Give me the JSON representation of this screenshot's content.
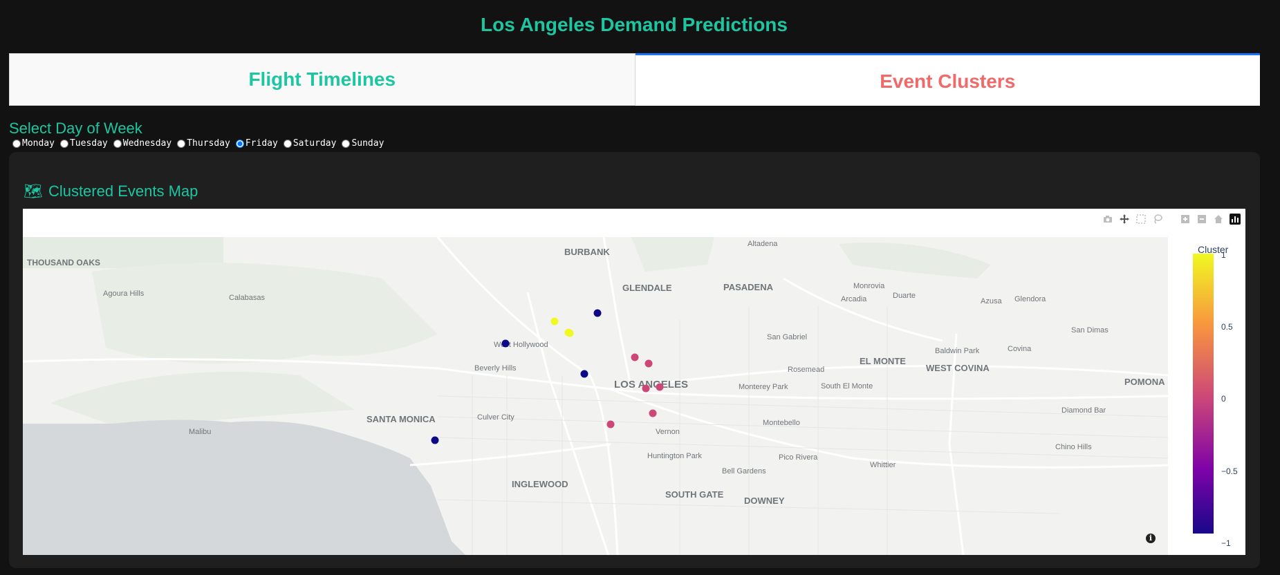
{
  "app": {
    "title": "Los Angeles Demand Predictions"
  },
  "tabs": [
    {
      "label": "Flight Timelines",
      "active": false
    },
    {
      "label": "Event Clusters",
      "active": true
    }
  ],
  "day_selector": {
    "label": "Select Day of Week",
    "options": [
      "Monday",
      "Tuesday",
      "Wednesday",
      "Thursday",
      "Friday",
      "Saturday",
      "Sunday"
    ],
    "selected": "Friday"
  },
  "map_section": {
    "icon": "map-icon",
    "emoji": "🗺",
    "title": "Clustered Events Map"
  },
  "modebar": [
    "camera-icon",
    "pan-icon",
    "box-select-icon",
    "lasso-icon",
    "zoom-in-icon",
    "zoom-out-icon",
    "home-icon",
    "plotly-logo-icon"
  ],
  "map_labels": [
    "THOUSAND OAKS",
    "Agoura Hills",
    "Calabasas",
    "Malibu",
    "BURBANK",
    "GLENDALE",
    "PASADENA",
    "Altadena",
    "Monrovia",
    "Duarte",
    "Arcadia",
    "Azusa",
    "Glendora",
    "San Dimas",
    "West Hollywood",
    "Beverly Hills",
    "LOS ANGELES",
    "SANTA MONICA",
    "Culver City",
    "San Gabriel",
    "EL MONTE",
    "Rosemead",
    "Baldwin Park",
    "Covina",
    "WEST COVINA",
    "Monterey Park",
    "South El Monte",
    "POMONA",
    "Diamond Bar",
    "Montebello",
    "Vernon",
    "Huntington Park",
    "Pico Rivera",
    "Whittier",
    "Chino Hills",
    "Bell Gardens",
    "INGLEWOOD",
    "SOUTH GATE",
    "DOWNEY"
  ],
  "chart_data": {
    "type": "scatter",
    "color_title": "Cluster",
    "color_scale": [
      "#0d0887",
      "#7e03a8",
      "#cc4778",
      "#f89540",
      "#f0f921"
    ],
    "color_range": [
      -1,
      1
    ],
    "color_ticks": [
      "1",
      "0.5",
      "0",
      "−0.5",
      "−1"
    ],
    "points": [
      {
        "cluster": 1
      },
      {
        "cluster": 1
      },
      {
        "cluster": 1
      },
      {
        "cluster": -1
      },
      {
        "cluster": -1
      },
      {
        "cluster": -1
      },
      {
        "cluster": -1
      },
      {
        "cluster": 0
      },
      {
        "cluster": 0
      },
      {
        "cluster": 0
      },
      {
        "cluster": 0
      },
      {
        "cluster": 0
      },
      {
        "cluster": 0
      }
    ]
  }
}
